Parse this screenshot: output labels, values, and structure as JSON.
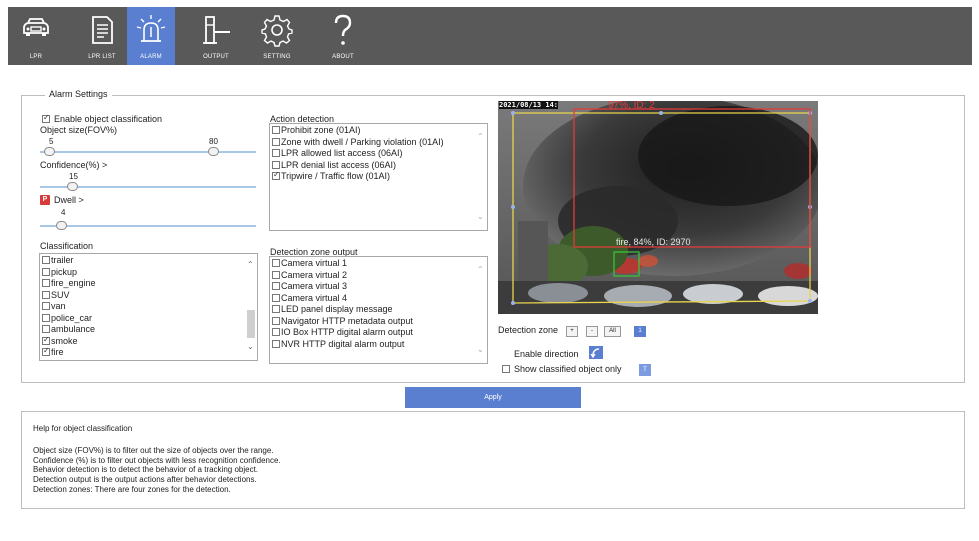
{
  "nav": {
    "items": [
      {
        "label": "LPR",
        "icon": "car-icon",
        "active": false
      },
      {
        "label": "LPR LIST",
        "icon": "list-document-icon",
        "active": false
      },
      {
        "label": "ALARM",
        "icon": "alarm-light-icon",
        "active": true
      },
      {
        "label": "OUTPUT",
        "icon": "gate-barrier-icon",
        "active": false
      },
      {
        "label": "SETTING",
        "icon": "gear-icon",
        "active": false
      },
      {
        "label": "ABOUT",
        "icon": "question-mark-icon",
        "active": false
      }
    ]
  },
  "alarm_settings": {
    "legend": "Alarm Settings",
    "enable_classification_label": "Enable object classification",
    "enable_classification_checked": true,
    "object_size_label": "Object size(FOV%)",
    "object_size_min": "5",
    "object_size_max": "80",
    "object_size_min_fraction": 0.05,
    "object_size_max_fraction": 0.8,
    "confidence_label": "Confidence(%) >",
    "confidence_value": "15",
    "confidence_fraction": 0.15,
    "dwell_badge": "P",
    "dwell_label": "Dwell >",
    "dwell_value": "4",
    "dwell_fraction": 0.08,
    "classification_label": "Classification",
    "classification_items": [
      {
        "label": "trailer",
        "checked": false
      },
      {
        "label": "pickup",
        "checked": false
      },
      {
        "label": "fire_engine",
        "checked": false
      },
      {
        "label": "SUV",
        "checked": false
      },
      {
        "label": "van",
        "checked": false
      },
      {
        "label": "police_car",
        "checked": false
      },
      {
        "label": "ambulance",
        "checked": false
      },
      {
        "label": "smoke",
        "checked": true
      },
      {
        "label": "fire",
        "checked": true
      }
    ],
    "action_detection_label": "Action detection",
    "action_items": [
      {
        "label": "Prohibit zone (01AI)",
        "checked": false
      },
      {
        "label": "Zone with dwell / Parking violation (01AI)",
        "checked": false
      },
      {
        "label": "LPR allowed list access (06AI)",
        "checked": false
      },
      {
        "label": "LPR denial list access (06AI)",
        "checked": false
      },
      {
        "label": "Tripwire / Traffic flow (01AI)",
        "checked": true
      }
    ],
    "zone_output_label": "Detection zone output",
    "zone_output_items": [
      {
        "label": "Camera virtual 1",
        "checked": false
      },
      {
        "label": "Camera virtual 2",
        "checked": false
      },
      {
        "label": "Camera virtual 3",
        "checked": false
      },
      {
        "label": "Camera virtual 4",
        "checked": false
      },
      {
        "label": "LED panel display message",
        "checked": false
      },
      {
        "label": "Navigator HTTP metadata output",
        "checked": false
      },
      {
        "label": "IO Box HTTP digital alarm output",
        "checked": false
      },
      {
        "label": "NVR HTTP digital alarm output",
        "checked": false
      }
    ],
    "video": {
      "timestamp": "2021/08/13 14:",
      "top_detection_label": "97%, ID: 2",
      "fire_detection_label": "fire, 84%, ID: 2970"
    },
    "detection_zone_label": "Detection zone",
    "zone_buttons": [
      "+",
      "-",
      "All"
    ],
    "zone_selected": "1",
    "enable_direction_label": "Enable direction",
    "show_classified_label": "Show classified object only",
    "show_classified_checked": false,
    "show_classified_chip": "T"
  },
  "apply_label": "Apply",
  "help": {
    "title": "Help for object classification",
    "lines": [
      "Object size (FOV%) is to filter out the size of objects over the range.",
      "Confidence (%) is to filter out objects with less recognition confidence.",
      "Behavior detection is to detect the behavior of a tracking object.",
      "Detection output is the output actions after behavior detections.",
      "Detection zones: There are four zones for the detection."
    ]
  },
  "colors": {
    "nav_bg": "#595959",
    "nav_active": "#5b7fd0",
    "apply_bg": "#5b7fd0",
    "zone_yellow": "#e8d44d",
    "zone_red": "#e23b3b",
    "fire_box": "#39c239"
  }
}
